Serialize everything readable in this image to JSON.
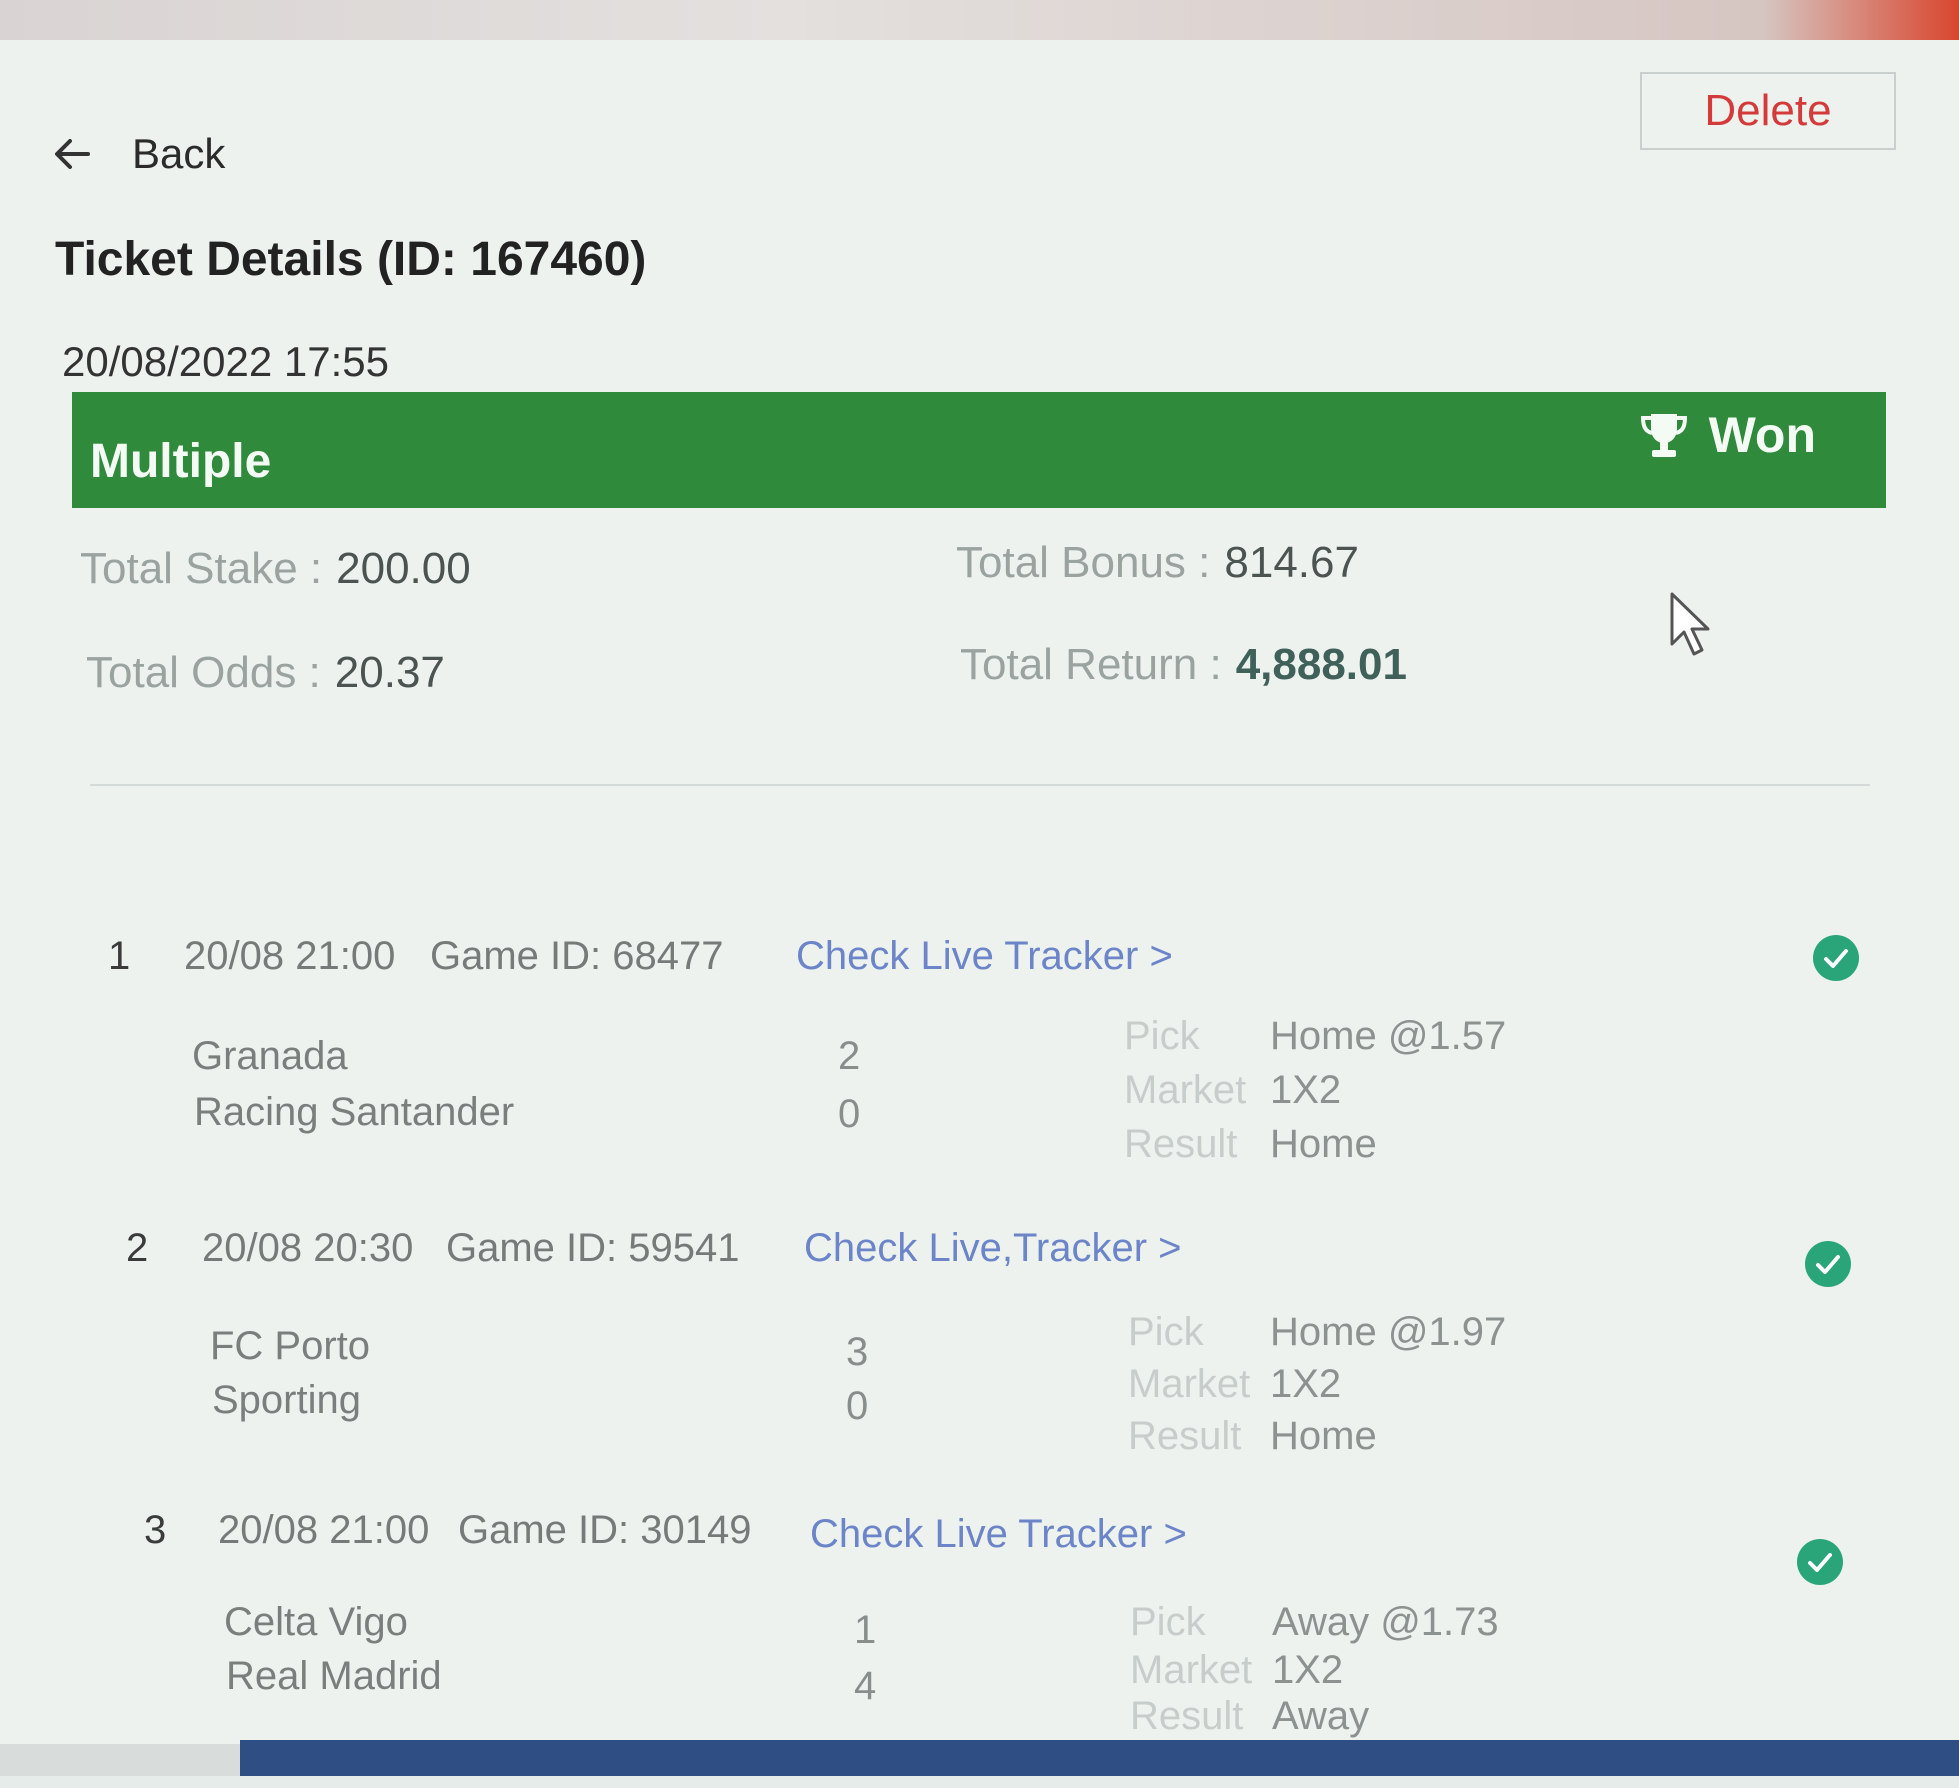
{
  "header": {
    "back_label": "Back",
    "delete_label": "Delete",
    "title": "Ticket Details (ID: 167460)",
    "date": "20/08/2022 17:55"
  },
  "status_bar": {
    "bet_type": "Multiple",
    "status": "Won",
    "status_icon": "trophy-icon",
    "color": "#2f8a3c"
  },
  "summary": {
    "stake_label": "Total Stake :",
    "stake_value": "200.00",
    "odds_label": "Total Odds :",
    "odds_value": "20.37",
    "bonus_label": "Total Bonus :",
    "bonus_value": "814.67",
    "return_label": "Total Return :",
    "return_value": "4,888.01"
  },
  "labels": {
    "pick": "Pick",
    "market": "Market",
    "result": "Result"
  },
  "legs": [
    {
      "num": "1",
      "time": "20/08 21:00",
      "game_id": "Game ID: 68477",
      "tracker": "Check Live Tracker >",
      "home": "Granada",
      "away": "Racing Santander",
      "home_score": "2",
      "away_score": "0",
      "pick": "Home @1.57",
      "market": "1X2",
      "result": "Home"
    },
    {
      "num": "2",
      "time": "20/08 20:30",
      "game_id": "Game ID: 59541",
      "tracker": "Check Live,Tracker >",
      "home": "FC Porto",
      "away": "Sporting",
      "home_score": "3",
      "away_score": "0",
      "pick": "Home @1.97",
      "market": "1X2",
      "result": "Home"
    },
    {
      "num": "3",
      "time": "20/08 21:00",
      "game_id": "Game ID: 30149",
      "tracker": "Check Live Tracker >",
      "home": "Celta Vigo",
      "away": "Real Madrid",
      "home_score": "1",
      "away_score": "4",
      "pick": "Away @1.73",
      "market": "1X2",
      "result": "Away"
    }
  ],
  "colors": {
    "won_check": "#2aa57a",
    "tracker_link": "#6c84c8",
    "delete": "#d43a3a"
  }
}
